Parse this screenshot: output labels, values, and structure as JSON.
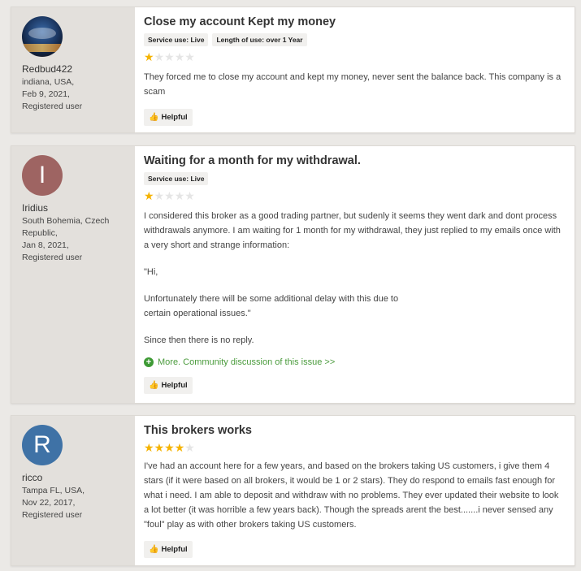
{
  "helpful_label": "Helpful",
  "reviews": [
    {
      "user": {
        "name": "Redbud422",
        "location": "indiana, USA,",
        "date": "Feb 9, 2021,",
        "status": "Registered user"
      },
      "title": "Close my account Kept my money",
      "tags": [
        "Service use: Live",
        "Length of use: over 1 Year"
      ],
      "rating": 1,
      "body": [
        "They forced me to close my account and kept my money, never sent the balance back. This company is a scam"
      ]
    },
    {
      "user": {
        "name": "Iridius",
        "initial": "I",
        "location": "South Bohemia, Czech Republic,",
        "date": "Jan 8, 2021,",
        "status": "Registered user"
      },
      "title": "Waiting for a month for my withdrawal.",
      "tags": [
        "Service use: Live"
      ],
      "rating": 1,
      "body": [
        "I considered this broker as a good trading partner, but sudenly it seems they went dark and dont process withdrawals anymore. I am waiting for 1 month for my withdrawal, they just replied to my emails once with a very short and strange information:",
        "\"Hi,",
        "Unfortunately there will be some additional delay with this due to",
        "certain operational issues.\"",
        "Since then there is no reply."
      ],
      "more_link": "More. Community discussion of this issue >>"
    },
    {
      "user": {
        "name": "ricco",
        "initial": "R",
        "location": "Tampa FL, USA,",
        "date": "Nov 22, 2017,",
        "status": "Registered user"
      },
      "title": "This brokers works",
      "rating": 4,
      "body": [
        "I've had an account here for a few years, and based on the brokers taking US customers, i give them 4 stars (if it were based on all brokers, it would be 1 or 2 stars). They do respond to emails fast enough for what i need. I am able to deposit and withdraw with no problems. They ever updated their website to look a lot better (it was horrible a few years back). Though the spreads arent the best.......i never sensed any \"foul\" play as with other brokers taking US customers."
      ]
    }
  ],
  "colors": {
    "avatar_i": "#9e6462",
    "avatar_r": "#3f72a6",
    "star": "#f5b301",
    "link": "#4a9b3c"
  }
}
